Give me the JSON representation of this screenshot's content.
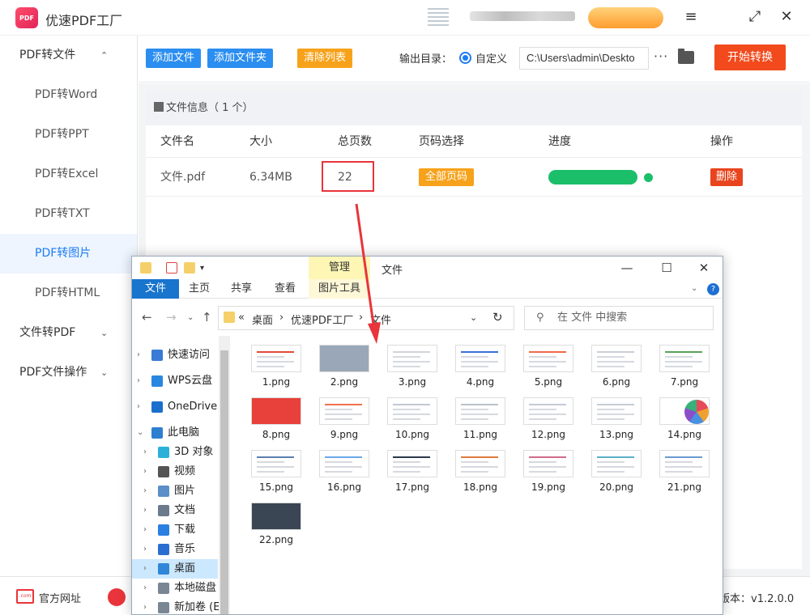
{
  "app": {
    "title": "优速PDF工厂",
    "logo_text": "PDF",
    "controls": {
      "menu": "≡",
      "fullscreen": "⤢",
      "close": "✕"
    }
  },
  "sidebar": {
    "items": [
      {
        "label": "PDF转文件",
        "type": "group",
        "chevron": "⌃"
      },
      {
        "label": "PDF转Word",
        "type": "sub"
      },
      {
        "label": "PDF转PPT",
        "type": "sub"
      },
      {
        "label": "PDF转Excel",
        "type": "sub"
      },
      {
        "label": "PDF转TXT",
        "type": "sub"
      },
      {
        "label": "PDF转图片",
        "type": "sub",
        "active": true
      },
      {
        "label": "PDF转HTML",
        "type": "sub"
      },
      {
        "label": "文件转PDF",
        "type": "group",
        "chevron": "⌄"
      },
      {
        "label": "PDF文件操作",
        "type": "group",
        "chevron": "⌄"
      }
    ]
  },
  "toolbar": {
    "add_file": "添加文件",
    "add_folder": "添加文件夹",
    "clear_list": "清除列表",
    "output_label": "输出目录：",
    "radio_custom": "自定义",
    "output_path": "C:\\Users\\admin\\Deskto",
    "more": "···",
    "start": "开始转换"
  },
  "file_panel": {
    "header": "文件信息（ 1 个）",
    "columns": [
      "文件名",
      "大小",
      "总页数",
      "页码选择",
      "进度",
      "操作"
    ],
    "rows": [
      {
        "name": "文件.pdf",
        "size": "6.34MB",
        "pages": "22",
        "page_select": "全部页码",
        "progress": 1.0,
        "action": "删除"
      }
    ]
  },
  "footer": {
    "website": "官方网址",
    "website_icon_text": ".com",
    "version": "版本：v1.2.0.0"
  },
  "explorer": {
    "ribbon_context": "管理",
    "title": "文件",
    "tabs": [
      "文件",
      "主页",
      "共享",
      "查看",
      "图片工具"
    ],
    "controls": {
      "minimize": "—",
      "maximize": "☐",
      "close": "✕"
    },
    "help": "?",
    "address": {
      "prefix": "«",
      "segments": [
        "桌面",
        "优速PDF工厂",
        "文件"
      ],
      "sep": "›"
    },
    "search_placeholder": "在 文件 中搜索",
    "nav": [
      {
        "label": "快速访问",
        "level": 0,
        "icon": "star-icon"
      },
      {
        "label": "WPS云盘",
        "level": 0,
        "icon": "cloud-icon"
      },
      {
        "label": "OneDrive",
        "level": 0,
        "icon": "onedrive-icon"
      },
      {
        "label": "此电脑",
        "level": 0,
        "icon": "computer-icon",
        "expanded": true
      },
      {
        "label": "3D 对象",
        "level": 1,
        "icon": "cube-icon"
      },
      {
        "label": "视频",
        "level": 1,
        "icon": "video-icon"
      },
      {
        "label": "图片",
        "level": 1,
        "icon": "picture-icon"
      },
      {
        "label": "文档",
        "level": 1,
        "icon": "document-icon"
      },
      {
        "label": "下载",
        "level": 1,
        "icon": "download-icon"
      },
      {
        "label": "音乐",
        "level": 1,
        "icon": "music-icon"
      },
      {
        "label": "桌面",
        "level": 1,
        "icon": "desktop-icon",
        "selected": true
      },
      {
        "label": "本地磁盘",
        "level": 1,
        "icon": "disk-icon"
      },
      {
        "label": "新加卷 (E",
        "level": 1,
        "icon": "disk-icon"
      }
    ],
    "files": [
      "1.png",
      "2.png",
      "3.png",
      "4.png",
      "5.png",
      "6.png",
      "7.png",
      "8.png",
      "9.png",
      "10.png",
      "11.png",
      "12.png",
      "13.png",
      "14.png",
      "15.png",
      "16.png",
      "17.png",
      "18.png",
      "19.png",
      "20.png",
      "21.png",
      "22.png"
    ]
  },
  "colors": {
    "accent_blue": "#2b8ef0",
    "accent_orange": "#f7a21b",
    "start_red": "#f24a1d",
    "progress_green": "#1bbf6a",
    "highlight_red": "#e8343a"
  }
}
